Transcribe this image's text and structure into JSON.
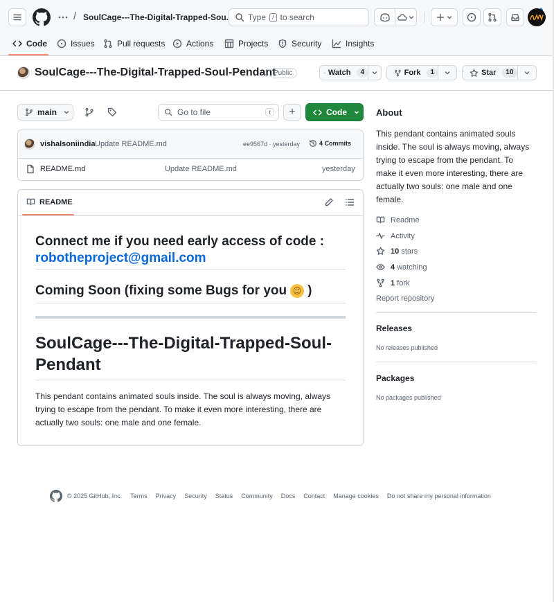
{
  "header": {
    "breadcrumb_sep": "/",
    "repo_short": "SoulCage---The-Digital-Trapped-Sou...",
    "search_prefix": "Type",
    "search_key": "/",
    "search_suffix": "to search"
  },
  "tabs": [
    {
      "label": "Code",
      "active": true
    },
    {
      "label": "Issues"
    },
    {
      "label": "Pull requests"
    },
    {
      "label": "Actions"
    },
    {
      "label": "Projects"
    },
    {
      "label": "Security"
    },
    {
      "label": "Insights"
    }
  ],
  "repo": {
    "title": "SoulCage---The-Digital-Trapped-Soul-Pendant",
    "visibility": "Public",
    "watch_label": "Watch",
    "watch_count": "4",
    "fork_label": "Fork",
    "fork_count": "1",
    "star_label": "Star",
    "star_count": "10"
  },
  "toolbar": {
    "branch": "main",
    "go_to_file_placeholder": "Go to file",
    "go_to_file_key": "t",
    "add_label": "+",
    "code_label": "Code"
  },
  "commit": {
    "author": "vishalsoniindia",
    "message": "Update README.md",
    "hash_time": "ee9567d · yesterday",
    "commits_label": "4 Commits"
  },
  "files": [
    {
      "name": "README.md",
      "message": "Update README.md",
      "time": "yesterday"
    }
  ],
  "readme": {
    "tab_label": "README",
    "h2_line1": "Connect me if you need early access of code :",
    "email": "robotheproject@gmail.com",
    "h2_second": "Coming Soon (fixing some Bugs for you",
    "h2_second_emoji": "😉",
    "h2_second_close": ")",
    "h1_line1": "SoulCage---The-Digital-Trapped-Soul-",
    "h1_line2": "Pendant",
    "paragraph_line1": "This pendant contains animated souls inside. The soul is always moving, always",
    "paragraph_line2": "trying to escape from the pendant. To make it even more interesting, there are",
    "paragraph_line3": "actually two souls: one male and one female."
  },
  "about": {
    "heading": "About",
    "desc_line1": "This pendant contains animated souls",
    "desc_line2": "inside. The soul is always moving, always",
    "desc_line3": "trying to escape from the pendant. To",
    "desc_line4": "make it even more interesting, there are",
    "desc_line5": "actually two souls: one male and one",
    "desc_line6": "female.",
    "readme_link": "Readme",
    "activity_link": "Activity",
    "stars_count": "10",
    "stars_label": "stars",
    "watching_count": "4",
    "watching_label": "watching",
    "fork_count": "1",
    "fork_label": "fork",
    "report": "Report repository"
  },
  "releases": {
    "heading": "Releases",
    "empty": "No releases published"
  },
  "packages": {
    "heading": "Packages",
    "empty": "No packages published"
  },
  "footer": {
    "copyright": "© 2025 GitHub, Inc.",
    "links": [
      "Terms",
      "Privacy",
      "Security",
      "Status",
      "Community",
      "Docs",
      "Contact",
      "Manage cookies",
      "Do not share my personal information"
    ]
  },
  "colors": {
    "accent": "#0969da",
    "code_button": "#1f883d",
    "active_tab": "#fd8c73",
    "border": "#d1d9e0"
  }
}
